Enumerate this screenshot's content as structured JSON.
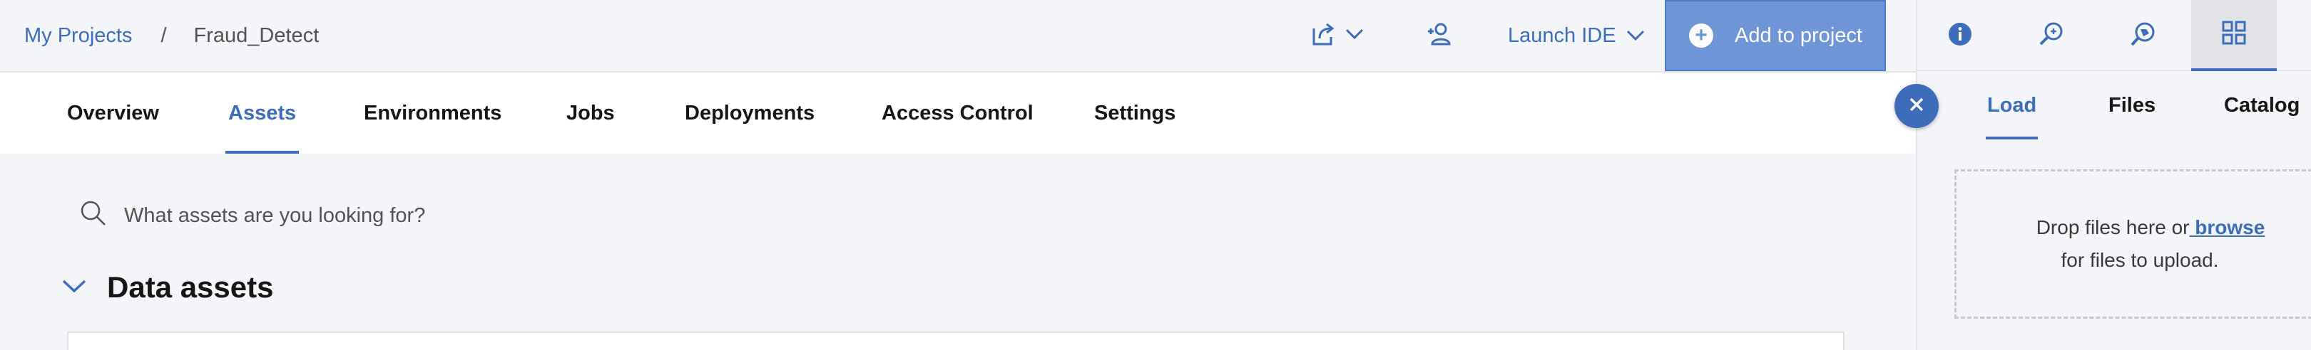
{
  "breadcrumb": {
    "items": [
      "My Projects",
      "Fraud_Detect"
    ],
    "separator": "/"
  },
  "toolbar": {
    "export_icon": "export-icon",
    "add_collaborator_icon": "add-collaborator-icon",
    "launch_ide_label": "Launch IDE",
    "add_to_project_label": "Add to project"
  },
  "tabs": [
    {
      "label": "Overview"
    },
    {
      "label": "Assets",
      "active": true
    },
    {
      "label": "Environments"
    },
    {
      "label": "Jobs"
    },
    {
      "label": "Deployments"
    },
    {
      "label": "Access Control"
    },
    {
      "label": "Settings"
    }
  ],
  "search": {
    "placeholder": "What assets are you looking for?"
  },
  "section": {
    "title": "Data assets"
  },
  "side_panel": {
    "icons": [
      "info-icon",
      "search-data-icon",
      "chat-icon",
      "data-grid-icon"
    ],
    "tabs": [
      {
        "label": "Load",
        "active": true
      },
      {
        "label": "Files"
      },
      {
        "label": "Catalog"
      }
    ],
    "drop_prefix": "Drop files here or",
    "browse_link": " browse",
    "drop_suffix": "for files to upload."
  },
  "colors": {
    "accent": "#3d6cb8",
    "primary_button": "#6e96d6",
    "background": "#f4f5f8"
  }
}
